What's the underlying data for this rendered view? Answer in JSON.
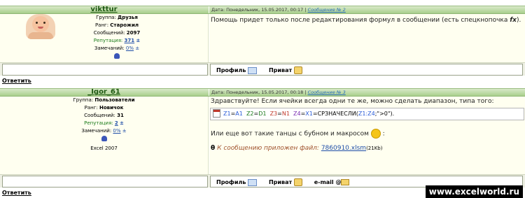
{
  "posts": [
    {
      "author": "vikttur",
      "date_label": "Дата: Понедельник, 15.05.2017, 00:17",
      "msg_link": "Сообщение №",
      "msg_num": "2",
      "group_label": "Группа:",
      "group": "Друзья",
      "rank_label": "Ранг:",
      "rank": "Старожил",
      "msgs_label": "Сообщений:",
      "msgs": "2097",
      "rep_label": "Репутация:",
      "rep": "371",
      "warn_label": "Замечаний:",
      "warn": "0%",
      "text": "Помощь придет только после редактирования формул в сообщении (есть спецкнопочка ",
      "text_code": "fx",
      "text_end": ").",
      "profile": "Профиль",
      "private": "Приват",
      "reply": "Ответить"
    },
    {
      "author": "_Igor_61",
      "date_label": "Дата: Понедельник, 15.05.2017, 00:18",
      "msg_link": "Сообщение №",
      "msg_num": "3",
      "group_label": "Группа:",
      "group": "Пользователи",
      "rank_label": "Ранг:",
      "rank": "Новичок",
      "msgs_label": "Сообщений:",
      "msgs": "31",
      "rep_label": "Репутация:",
      "rep": "2",
      "warn_label": "Замечаний:",
      "warn": "0%",
      "excel": "Excel 2007",
      "text": "Здравствуйте! Если ячейки всегда одни те же, можно сделать диапазон, типа того:",
      "formula": {
        "p1": "Z1",
        "e1": "=",
        "p2": "A1",
        "s1": "  ",
        "p3": "Z2",
        "e2": "=",
        "p4": "D1",
        "s2": "  ",
        "p5": "Z3",
        "e3": "=",
        "p6": "N1",
        "s3": "  ",
        "p7": "Z4",
        "e4": "=",
        "p8": "X1",
        "rest1": "=СРЗНАЧЕСЛИ(",
        "p9": "Z1:Z4",
        "rest2": ";\">0\")."
      },
      "text2": "Или еще вот такие танцы с бубном и макросом",
      "text2_end": " :",
      "attach_label": "К сообщению приложен файл:",
      "attach_file": "7860910.xlsm",
      "attach_size": "(21Kb)",
      "profile": "Профиль",
      "private": "Приват",
      "email": "e-mail",
      "reply": "Ответить"
    }
  ],
  "watermark": "www.excelworld.ru"
}
